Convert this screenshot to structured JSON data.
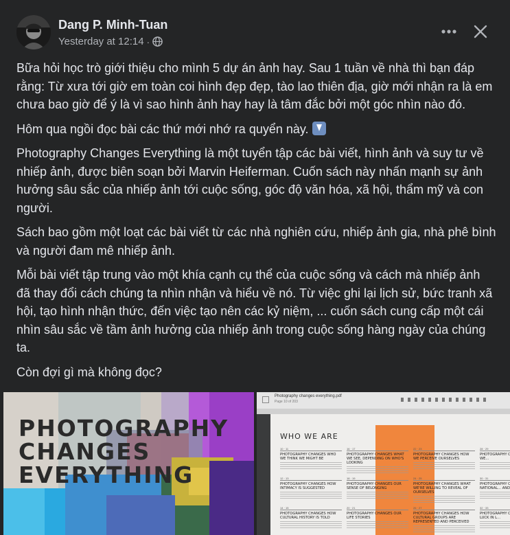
{
  "post": {
    "author": "Dang P. Minh-Tuan",
    "timestamp": "Yesterday at 12:14",
    "separator": "·",
    "audience_icon": "globe-icon",
    "paragraphs": [
      "Bữa hỏi học trò giới thiệu cho mình 5 dự án ảnh hay. Sau 1 tuần về nhà thì bạn đáp rằng: Từ xưa tới giờ em toàn coi hình đẹp đẹp, tào lao thiên địa, giờ mới nhận ra là em chưa bao giờ để ý là vì sao hình ảnh hay hay là tâm đắc bởi một góc nhìn nào đó.",
      "Hôm qua ngồi đọc bài các thứ mới nhớ ra quyển này.",
      "Photography Changes Everything là một tuyển tập các bài viết, hình ảnh và suy tư về nhiếp ảnh, được biên soạn bởi Marvin Heiferman. Cuốn sách này nhấn mạnh sự ảnh hưởng sâu sắc của nhiếp ảnh tới cuộc sống, góc độ văn hóa, xã hội, thẩm mỹ và con người.",
      "Sách bao gồm một loạt các bài viết từ các nhà nghiên cứu, nhiếp ảnh gia, nhà phê bình và người đam mê nhiếp ảnh.",
      "Mỗi bài viết tập trung vào một khía cạnh cụ thể của cuộc sống và cách mà nhiếp ảnh đã thay đổi cách chúng ta nhìn nhận và hiểu về nó. Từ việc ghi lại lịch sử, bức tranh xã hội, tạo hình nhận thức, đến việc tạo nên các kỷ niệm, ... cuốn sách cung cấp một cái nhìn sâu sắc về tầm ảnh hưởng của nhiếp ảnh trong cuộc sống hàng ngày của chúng ta.",
      "Còn đợi gì mà không đọc?"
    ]
  },
  "images": {
    "cover": {
      "title_lines": [
        "PHOTOGRAPHY",
        "CHANGES",
        "EVERYTHING"
      ]
    },
    "pdf": {
      "file_name": "Photography changes everything.pdf",
      "page_info": "Page 10 of 203",
      "heading": "WHO WE ARE",
      "col1": [
        {
          "num": "10 · 11",
          "title": "PHOTOGRAPHY CHANGES WHO WE THINK WE MIGHT BE"
        },
        {
          "num": "12 · 13",
          "title": "PHOTOGRAPHY CHANGES HOW INTIMACY IS SUGGESTED"
        },
        {
          "num": "14 · 15",
          "title": "PHOTOGRAPHY CHANGES HOW CULTURAL HISTORY IS TOLD"
        }
      ],
      "col2": [
        {
          "num": "16 · 17",
          "title": "PHOTOGRAPHY CHANGES WHAT WE SEE, DEPENDING ON WHO'S LOOKING"
        },
        {
          "num": "18 · 19",
          "title": "PHOTOGRAPHY CHANGES OUR SENSE OF BELONGING"
        },
        {
          "num": "20 · 21",
          "title": "PHOTOGRAPHY CHANGES OUR LIFE STORIES"
        }
      ],
      "col3": [
        {
          "num": "22 · 23",
          "title": "PHOTOGRAPHY CHANGES HOW WE PERCEIVE OURSELVES"
        },
        {
          "num": "24 · 25",
          "title": "PHOTOGRAPHY CHANGES WHAT WE'RE WILLING TO REVEAL OF OURSELVES"
        },
        {
          "num": "26 · 27",
          "title": "PHOTOGRAPHY CHANGES HOW CULTURAL GROUPS ARE REPRESENTED AND PERCEIVED"
        }
      ],
      "col4": [
        {
          "num": "28 · 29",
          "title": "PHOTOGRAPHY CHANGES HOW WE..."
        },
        {
          "num": "30 · 31",
          "title": "PHOTOGRAPHY CHANGES HOW NATIONAL... AND PORTRAITS"
        },
        {
          "num": "32 · 33",
          "title": "PHOTOGRAPHY CHANGES OUR LUCK IN L..."
        }
      ]
    }
  }
}
